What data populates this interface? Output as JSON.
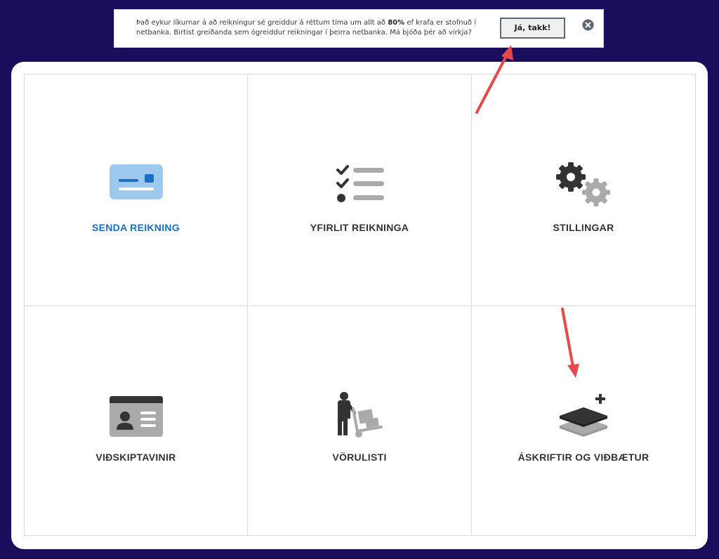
{
  "banner": {
    "text_before": "Það eykur líkurnar á að reikningur sé greiddur á réttum tíma um allt að ",
    "text_bold": "80%",
    "text_after": " ef krafa er stofnuð í netbanka. Birtist greiðanda sem ógreiddur reikningar í þeirra netbanka. Má bjóða þér að virkja?",
    "accept_label": "Já, takk!",
    "close_icon": "close-circle-icon"
  },
  "tiles": [
    {
      "label": "SENDA REIKNING",
      "icon": "invoice-card-icon"
    },
    {
      "label": "YFIRLIT REIKNINGA",
      "icon": "checklist-icon"
    },
    {
      "label": "STILLINGAR",
      "icon": "gears-icon"
    },
    {
      "label": "VIÐSKIPTAVINIR",
      "icon": "contact-card-icon"
    },
    {
      "label": "VÖRULISTI",
      "icon": "dolly-icon"
    },
    {
      "label": "ÁSKRIFTIR OG VIÐBÆTUR",
      "icon": "layers-plus-icon"
    }
  ],
  "colors": {
    "background": "#1a0e5c",
    "active_label": "#1a6fc4",
    "annotation_arrow": "#e8474c"
  }
}
